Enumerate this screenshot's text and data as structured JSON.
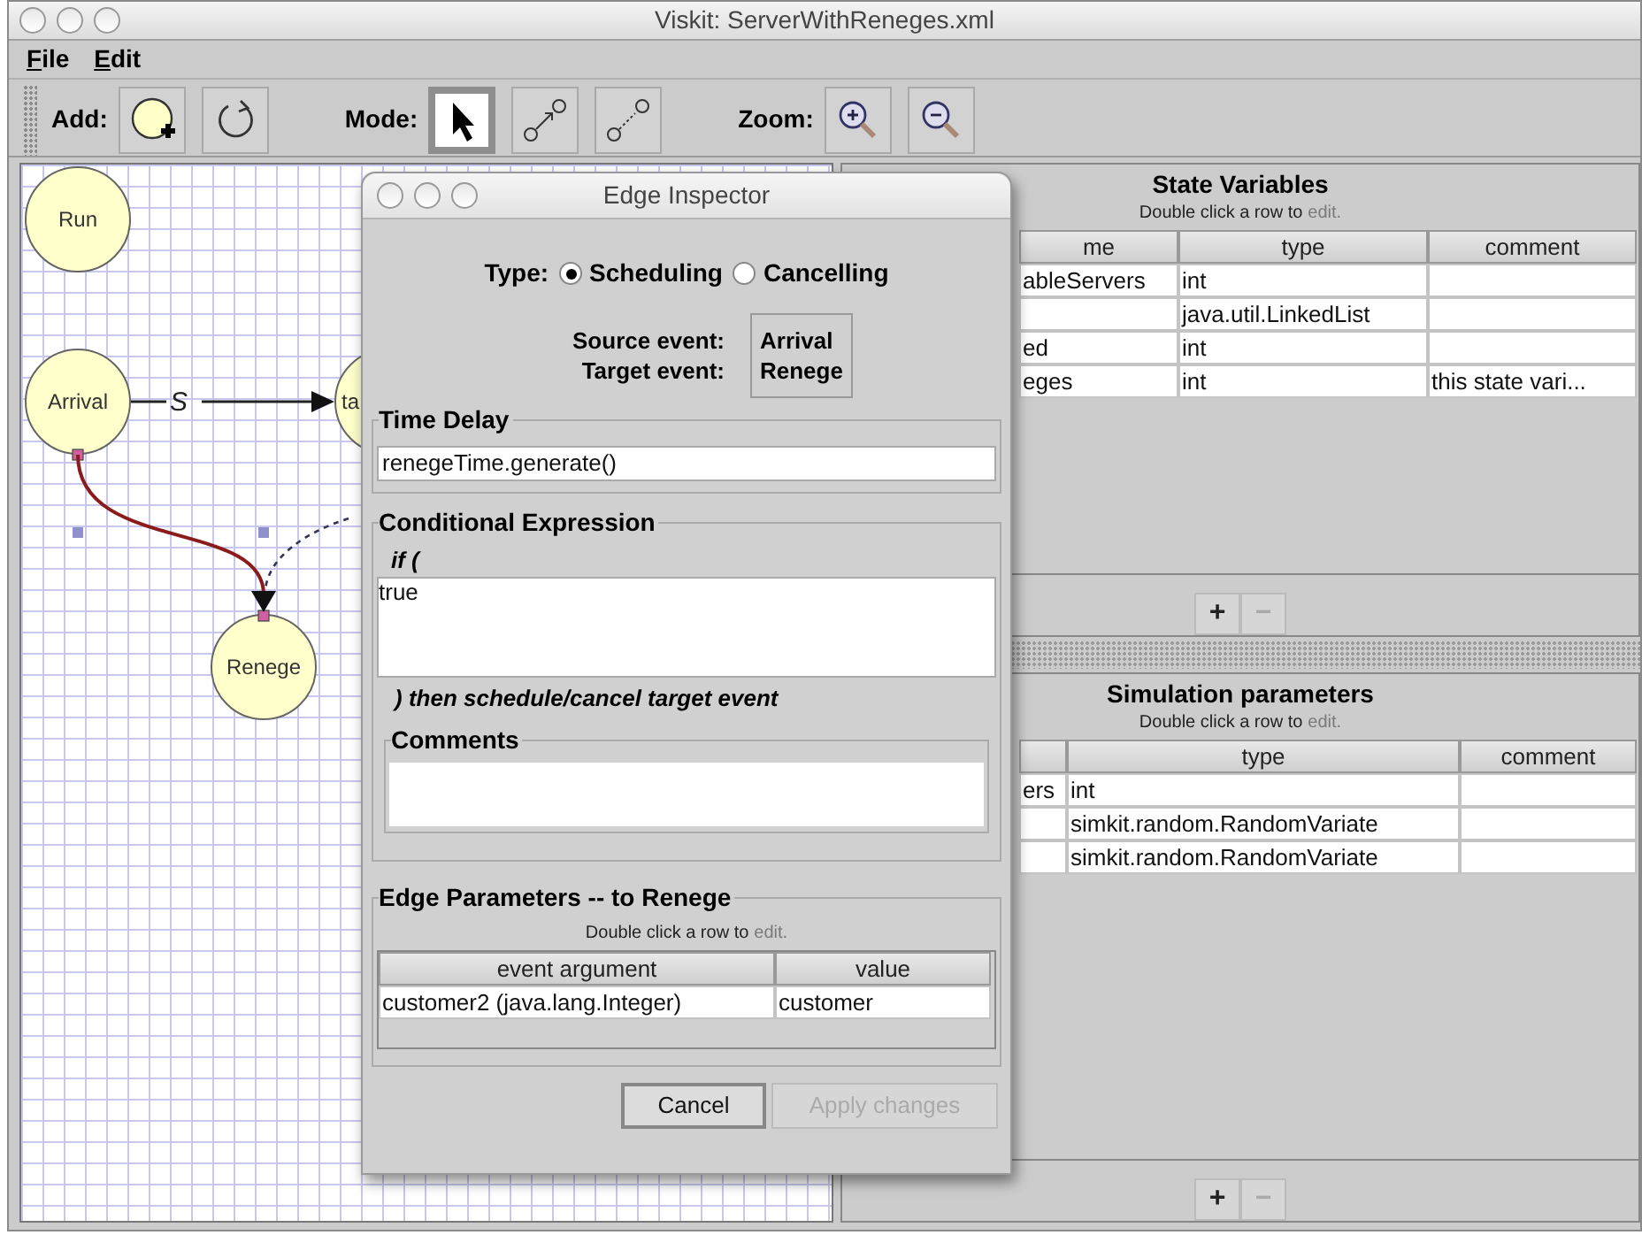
{
  "window": {
    "title": "Viskit: ServerWithReneges.xml"
  },
  "menu": [
    {
      "label": "File"
    },
    {
      "label": "Edit"
    }
  ],
  "toolbar": {
    "groups": [
      {
        "label": "Add:",
        "buttons": [
          {
            "kind": "add_node",
            "pressed": false
          },
          {
            "kind": "reset",
            "pressed": false
          }
        ]
      },
      {
        "label": "Mode:",
        "buttons": [
          {
            "kind": "select",
            "pressed": true
          },
          {
            "kind": "connect",
            "pressed": false
          },
          {
            "kind": "connect_cancel",
            "pressed": false
          }
        ]
      },
      {
        "label": "Zoom:",
        "buttons": [
          {
            "kind": "zoom_in",
            "pressed": false
          },
          {
            "kind": "zoom_out",
            "pressed": false
          }
        ]
      }
    ]
  },
  "canvas": {
    "nodes": [
      {
        "label": "Run"
      },
      {
        "label": "Arrival"
      },
      {
        "label": "ta"
      },
      {
        "label": "Renege"
      }
    ],
    "edges": [
      {
        "kind": "scheduling",
        "label": "S",
        "selected": false
      },
      {
        "kind": "scheduling",
        "selected": true
      },
      {
        "kind": "cancelling",
        "selected": false
      }
    ]
  },
  "state_variables": {
    "title": "State Variables",
    "hint": "Double click a row to",
    "hint_link": "edit.",
    "columns": [
      "me",
      "type",
      "comment"
    ],
    "rows": [
      [
        "ableServers",
        "int",
        ""
      ],
      [
        "",
        "java.util.LinkedList",
        ""
      ],
      [
        "ed",
        "int",
        ""
      ],
      [
        "eges",
        "int",
        "this state vari..."
      ]
    ],
    "buttons": [
      {
        "label": "+",
        "disabled": false
      },
      {
        "label": "−",
        "disabled": true
      }
    ]
  },
  "simulation_parameters": {
    "title": "Simulation parameters",
    "hint": "Double click a row to",
    "hint_link": "edit.",
    "columns": [
      "",
      "type",
      "comment"
    ],
    "rows": [
      [
        "ers",
        "int",
        ""
      ],
      [
        "",
        "simkit.random.RandomVariate",
        ""
      ],
      [
        "",
        "simkit.random.RandomVariate",
        ""
      ]
    ],
    "buttons": [
      {
        "label": "+",
        "disabled": false
      },
      {
        "label": "−",
        "disabled": true
      }
    ]
  },
  "dialog": {
    "title": "Edge Inspector",
    "type": {
      "label": "Type:",
      "options": [
        {
          "label": "Scheduling",
          "selected": true
        },
        {
          "label": "Cancelling",
          "selected": false
        }
      ]
    },
    "source_label": "Source event:",
    "target_label": "Target event:",
    "source_value": "Arrival",
    "target_value": "Renege",
    "time_delay": {
      "title": "Time Delay",
      "value": "renegeTime.generate()"
    },
    "conditional": {
      "title": "Conditional Expression",
      "prefix": "if (",
      "value": "true",
      "suffix": ") then schedule/cancel target event"
    },
    "comments": {
      "title": "Comments"
    },
    "edge_parameters": {
      "title": "Edge Parameters -- to Renege",
      "hint": "Double click a row to",
      "hint_link": "edit.",
      "columns": [
        "event argument",
        "value"
      ],
      "rows": [
        [
          "customer2 (java.lang.Integer)",
          "customer"
        ]
      ]
    },
    "buttons": [
      {
        "label": "Cancel",
        "disabled": false
      },
      {
        "label": "Apply changes",
        "disabled": true
      }
    ]
  }
}
